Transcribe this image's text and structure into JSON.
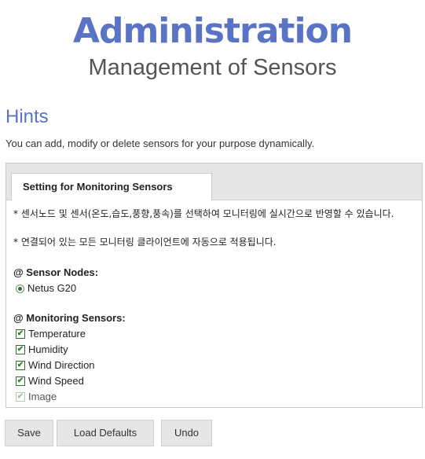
{
  "header": {
    "title": "Administration",
    "subtitle": "Management of Sensors"
  },
  "hints": {
    "heading": "Hints",
    "text": "You can add, modify or delete sensors for your purpose dynamically."
  },
  "panel": {
    "tab_label": "Setting for Monitoring Sensors",
    "notes": [
      "* 센서노드 및 센서(온도,습도,풍향,풍속)를 선택하여 모니터링에 실시간으로 반영할 수 있습니다.",
      "* 연결되어 있는 모든 모니터링 클라이언트에 자동으로 적용됩니다."
    ],
    "sensor_nodes_label": "@ Sensor Nodes:",
    "sensor_nodes": [
      {
        "label": "Netus G20",
        "selected": true
      }
    ],
    "monitoring_sensors_label": "@ Monitoring Sensors:",
    "monitoring_sensors": [
      {
        "label": "Temperature",
        "checked": true,
        "disabled": false
      },
      {
        "label": "Humidity",
        "checked": true,
        "disabled": false
      },
      {
        "label": "Wind Direction",
        "checked": true,
        "disabled": false
      },
      {
        "label": "Wind Speed",
        "checked": true,
        "disabled": false
      },
      {
        "label": "Image",
        "checked": true,
        "disabled": true
      }
    ]
  },
  "buttons": {
    "save": "Save",
    "load_defaults": "Load Defaults",
    "undo": "Undo"
  },
  "colors": {
    "accent": "#5a73c4",
    "check": "#2f7f2f"
  }
}
